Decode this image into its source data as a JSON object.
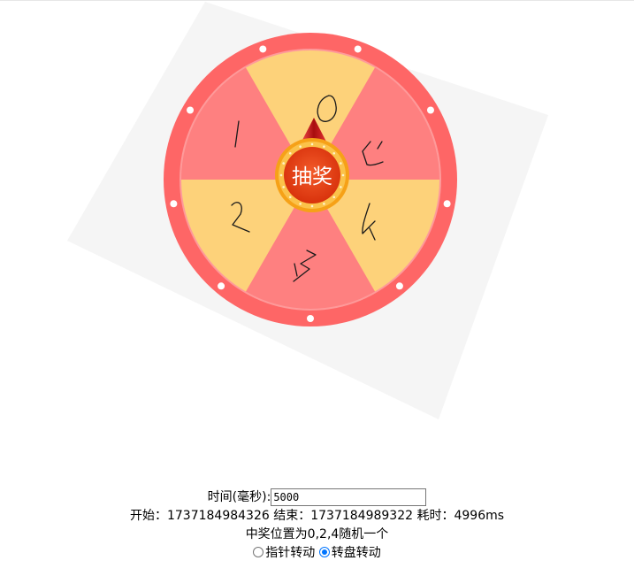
{
  "wheel": {
    "center_button_label": "抽奖",
    "segments": [
      {
        "index": 0,
        "color": "#fdd27a",
        "drawn_label": "0"
      },
      {
        "index": 1,
        "color": "#fe8080",
        "drawn_label": "5"
      },
      {
        "index": 2,
        "color": "#fdd27a",
        "drawn_label": "4"
      },
      {
        "index": 3,
        "color": "#fe8080",
        "drawn_label": "3"
      },
      {
        "index": 4,
        "color": "#fdd27a",
        "drawn_label": "2"
      },
      {
        "index": 5,
        "color": "#fe8080",
        "drawn_label": "1"
      }
    ],
    "colors": {
      "ring": "#fe6666",
      "inner_ring": "#fe9a9a",
      "dot": "#ffffff",
      "button_outer": "#f6a117",
      "button_inner": "#ec3d10",
      "pointer": "#d91414",
      "backdrop": "#f5f5f5"
    }
  },
  "controls": {
    "time_label": "时间(毫秒):",
    "time_value": "5000",
    "start_label": "开始：",
    "start_value": "1737184984326",
    "end_label": "结束：",
    "end_value": "1737184989322",
    "elapsed_label": "耗时：",
    "elapsed_value": "4996ms",
    "prize_note": "中奖位置为0,2,4随机一个",
    "mode_options": [
      {
        "label": "指针转动",
        "checked": false
      },
      {
        "label": "转盘转动",
        "checked": true
      }
    ]
  }
}
